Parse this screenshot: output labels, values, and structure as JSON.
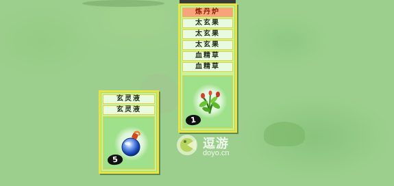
{
  "right_panel": {
    "header": "炼丹炉",
    "ingredients": [
      "太玄果",
      "太玄果",
      "太玄果",
      "血精草",
      "血精草"
    ],
    "item_icon": "herb-plant-icon",
    "count": "1"
  },
  "left_panel": {
    "ingredients": [
      "玄灵液",
      "玄灵液"
    ],
    "item_icon": "potion-flask-icon",
    "count": "5"
  },
  "watermark": {
    "title": "逗游",
    "url": "doyo.cn"
  },
  "colors": {
    "panel_bg": "#c7f29e",
    "panel_border": "#e9e34a",
    "header_bg": "#f7a47a",
    "label_bg": "#e8fbe0",
    "grass": "#9ccf8d"
  }
}
